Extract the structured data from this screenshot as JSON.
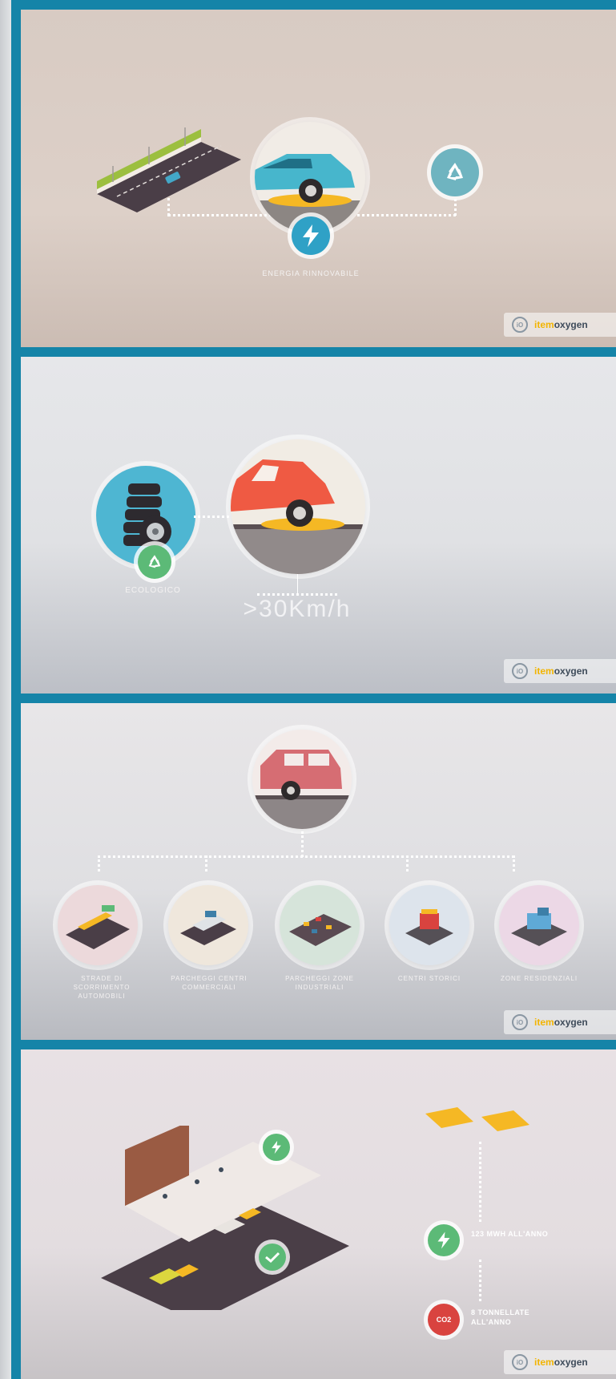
{
  "brand": {
    "prefix": "item",
    "name": "oxygen",
    "mark": "iO"
  },
  "panels": [
    {
      "caption": "ENERGIA RINNOVABILE",
      "icons": [
        "bike-lane-road",
        "car-on-bump",
        "lightning-icon",
        "recycle-icon"
      ]
    },
    {
      "caption": "ECOLOGICO",
      "speed": ">30Km/h",
      "icons": [
        "tires-stack",
        "recycle-icon",
        "car-on-bump"
      ]
    },
    {
      "locations": [
        {
          "label": "STRADE DI SCORRIMENTO AUTOMOBILI"
        },
        {
          "label": "PARCHEGGI CENTRI COMMERCIALI"
        },
        {
          "label": "PARCHEGGI ZONE INDUSTRIALI"
        },
        {
          "label": "CENTRI STORICI"
        },
        {
          "label": "ZONE RESIDENZIALI"
        }
      ]
    },
    {
      "energy_label": "123 MWH ALL'ANNO",
      "co2_label": "8 TONNELLATE ALL'ANNO",
      "co2_badge": "CO2"
    }
  ],
  "colors": {
    "frame": "#1584a8",
    "badge_blue": "#2fa1c6",
    "badge_green": "#5cba77",
    "badge_red": "#d9433f",
    "bump_yellow": "#f5b824"
  }
}
